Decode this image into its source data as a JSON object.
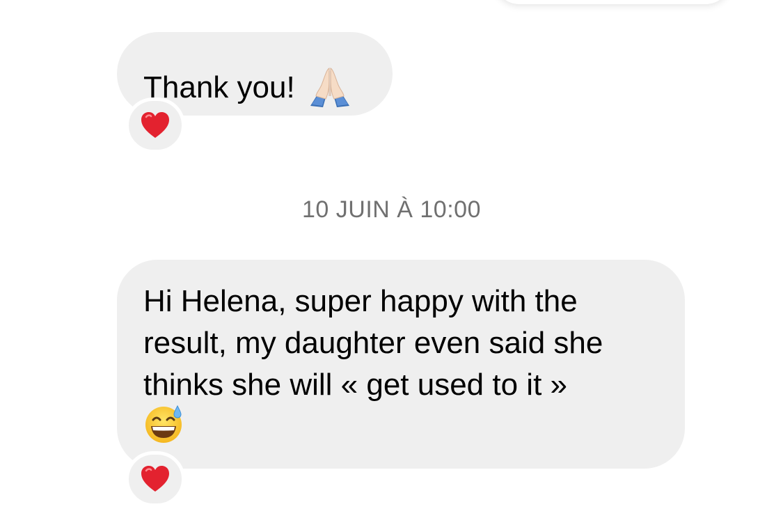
{
  "conversation": {
    "messages": [
      {
        "text": "Thank you!",
        "emoji": "folded-hands",
        "reaction": "red-heart"
      },
      {
        "lines": [
          "Hi Helena, super happy with the",
          "result, my daughter even said she",
          "thinks she will « get used to it »"
        ],
        "emoji": "grinning-face-with-sweat",
        "reaction": "red-heart"
      }
    ],
    "timestamp": "10 JUIN À 10:00"
  },
  "colors": {
    "bubble_bg": "#efefef",
    "timestamp_text": "#707070",
    "heart": "#e3222f"
  }
}
